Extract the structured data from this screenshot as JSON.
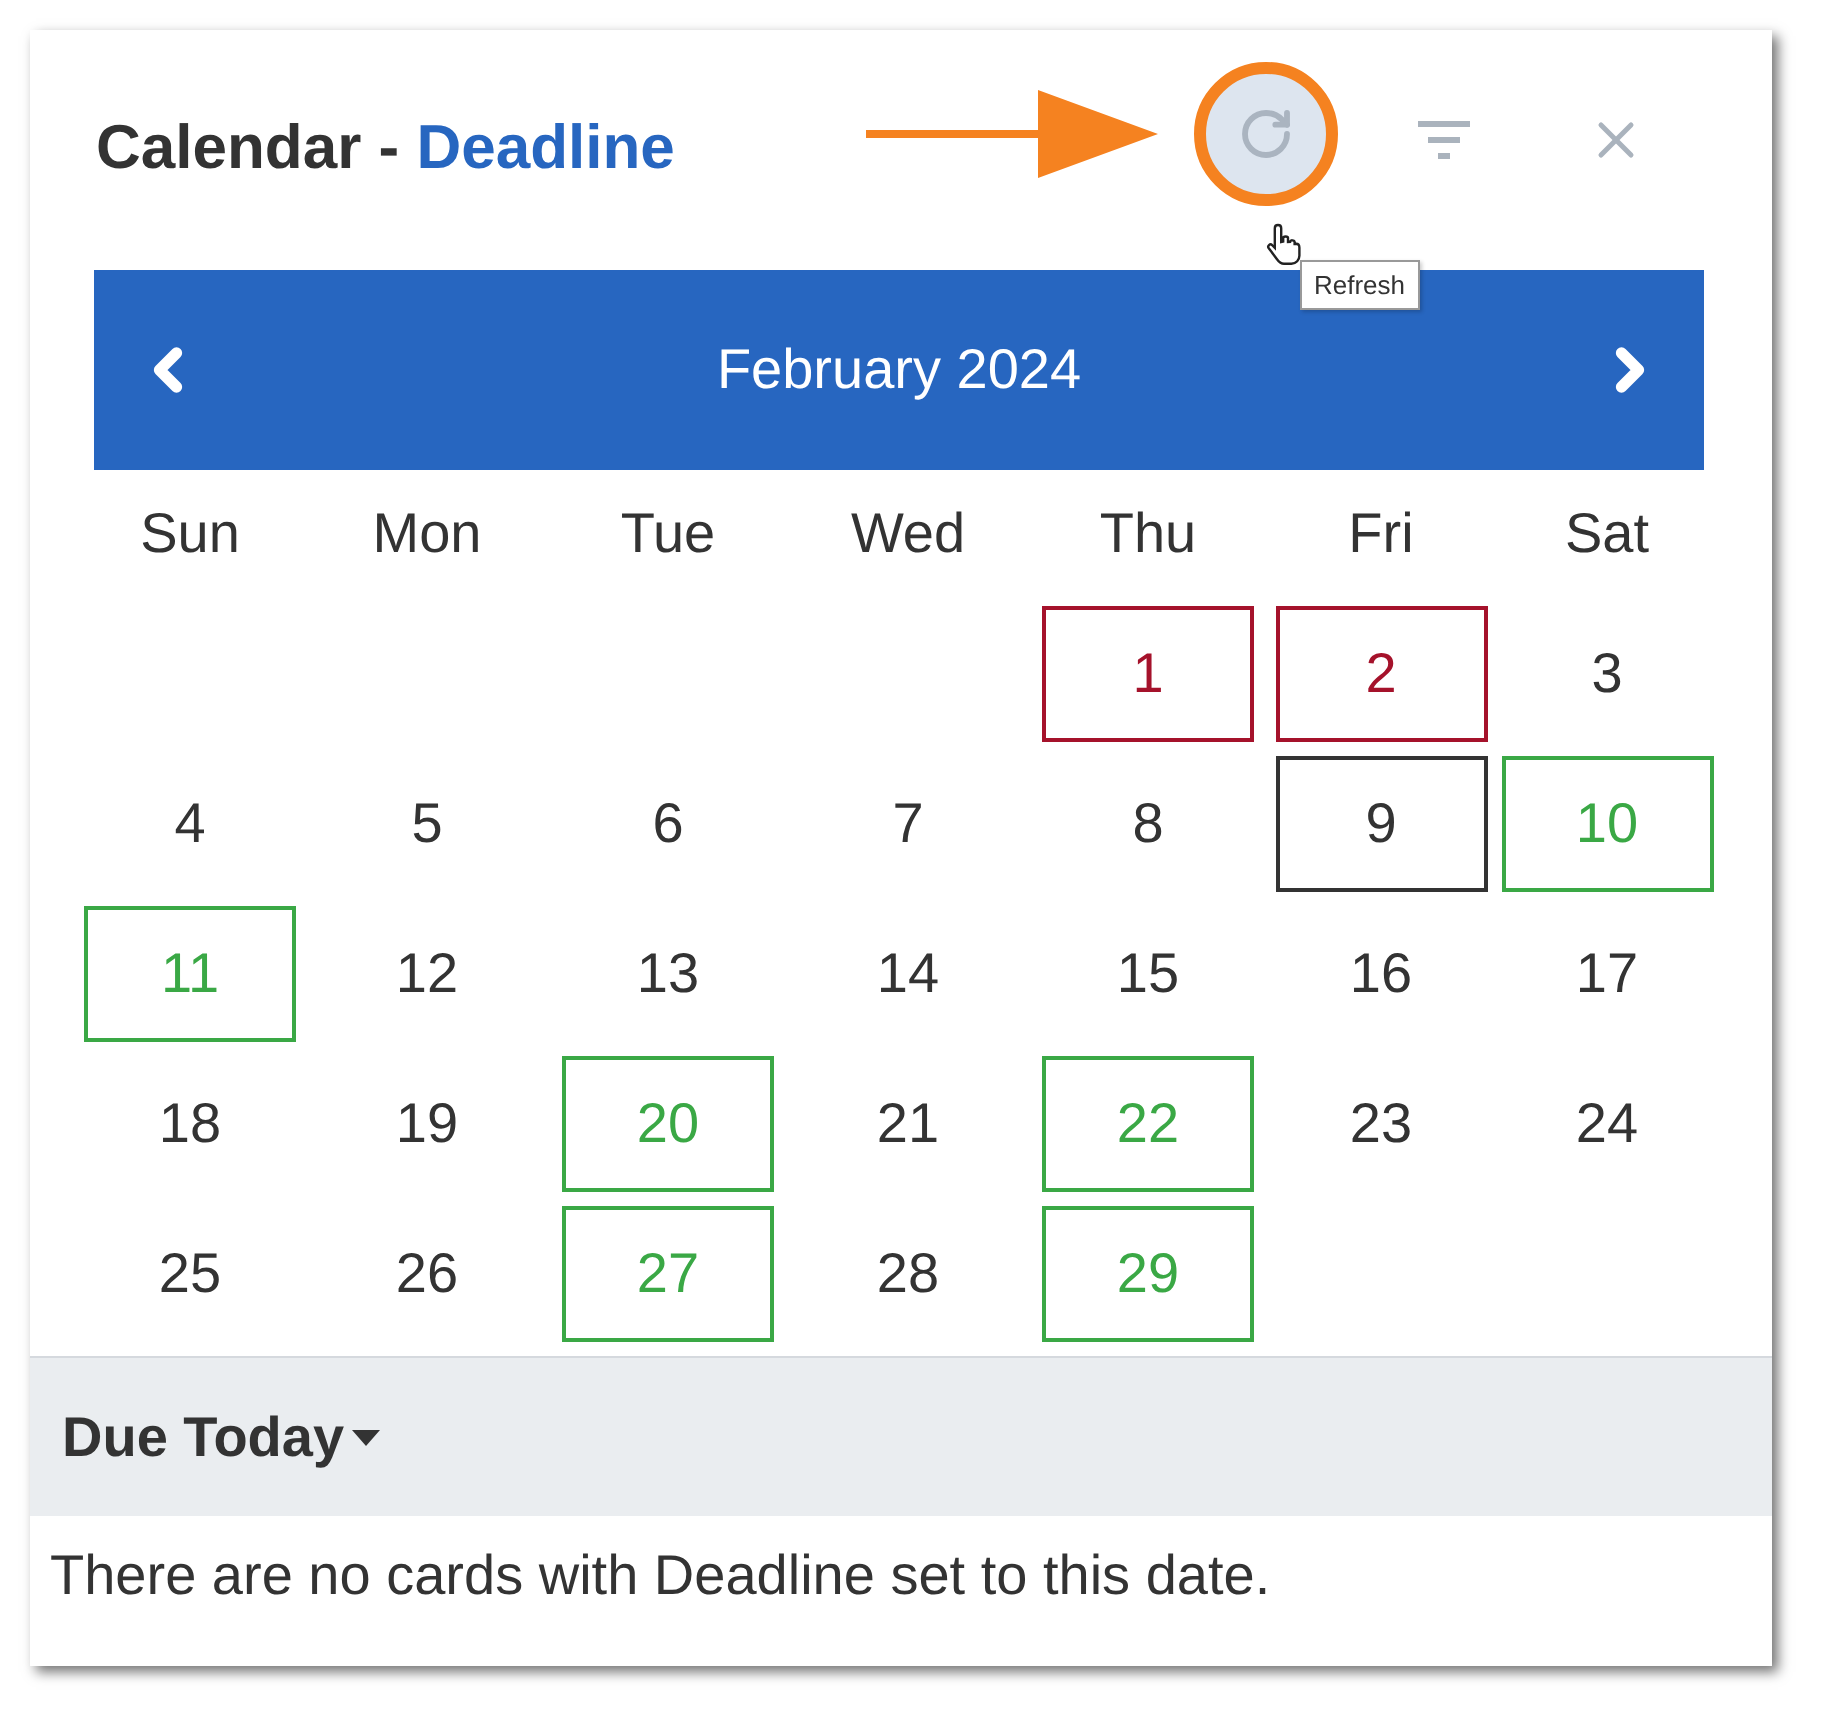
{
  "header": {
    "title": "Calendar - ",
    "board": "Deadline",
    "tooltip": "Refresh"
  },
  "month": "February 2024",
  "weekdays": [
    "Sun",
    "Mon",
    "Tue",
    "Wed",
    "Thu",
    "Fri",
    "Sat"
  ],
  "weeks": [
    [
      {
        "kind": "blank"
      },
      {
        "kind": "blank"
      },
      {
        "kind": "blank"
      },
      {
        "kind": "blank"
      },
      {
        "day": "1",
        "kind": "overdue"
      },
      {
        "day": "2",
        "kind": "overdue"
      },
      {
        "day": "3",
        "kind": "plain"
      }
    ],
    [
      {
        "day": "4",
        "kind": "plain"
      },
      {
        "day": "5",
        "kind": "plain"
      },
      {
        "day": "6",
        "kind": "plain"
      },
      {
        "day": "7",
        "kind": "plain"
      },
      {
        "day": "8",
        "kind": "plain"
      },
      {
        "day": "9",
        "kind": "today"
      },
      {
        "day": "10",
        "kind": "due"
      }
    ],
    [
      {
        "day": "11",
        "kind": "due"
      },
      {
        "day": "12",
        "kind": "plain"
      },
      {
        "day": "13",
        "kind": "plain"
      },
      {
        "day": "14",
        "kind": "plain"
      },
      {
        "day": "15",
        "kind": "plain"
      },
      {
        "day": "16",
        "kind": "plain"
      },
      {
        "day": "17",
        "kind": "plain"
      }
    ],
    [
      {
        "day": "18",
        "kind": "plain"
      },
      {
        "day": "19",
        "kind": "plain"
      },
      {
        "day": "20",
        "kind": "due"
      },
      {
        "day": "21",
        "kind": "plain"
      },
      {
        "day": "22",
        "kind": "due"
      },
      {
        "day": "23",
        "kind": "plain"
      },
      {
        "day": "24",
        "kind": "plain"
      }
    ],
    [
      {
        "day": "25",
        "kind": "plain"
      },
      {
        "day": "26",
        "kind": "plain"
      },
      {
        "day": "27",
        "kind": "due"
      },
      {
        "day": "28",
        "kind": "plain"
      },
      {
        "day": "29",
        "kind": "due"
      },
      {
        "kind": "blank"
      },
      {
        "kind": "blank"
      }
    ]
  ],
  "section": {
    "title": "Due Today",
    "message": "There are no cards with Deadline set to this date."
  }
}
